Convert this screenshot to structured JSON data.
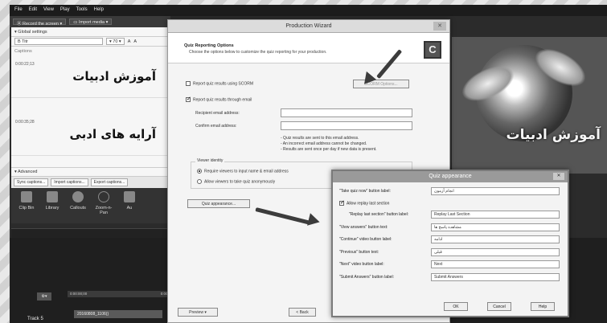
{
  "menu": [
    "File",
    "Edit",
    "View",
    "Play",
    "Tools",
    "Help"
  ],
  "toolbar": {
    "record": "⦿ Record the screen ▾",
    "import": "▭ Import media ▾"
  },
  "captions": {
    "global_settings": "▾ Global settings",
    "font_name": "B Titr",
    "font_size": "▾ 70 ▾",
    "header": "Captions",
    "items": [
      {
        "time": "0:00:22;13",
        "text": "آموزش ادبیات"
      },
      {
        "time": "0:00:35;28",
        "text": "آرایه های ادبی"
      }
    ],
    "advanced": "▾ Advanced",
    "buttons": [
      "Sync captions...",
      "Import captions...",
      "Export captions..."
    ]
  },
  "tools": [
    "Clip Bin",
    "Library",
    "Callouts",
    "Zoom-n-Pan",
    "Au"
  ],
  "timeline": {
    "ruler_a": "0:00:00;00",
    "ruler_b": "0:00:10;00",
    "track": "Track 5",
    "clip": "20160808_1106()"
  },
  "preview": {
    "text": "آموزش ادبیات"
  },
  "wizard": {
    "title": "Production Wizard",
    "heading": "Quiz Reporting Options",
    "subheading": "Choose the options below to customize the quiz reporting for your production.",
    "logo": "C",
    "report_scorm": "Report quiz results using SCORM",
    "scorm_options": "SCORM Options...",
    "report_email": "Report quiz results through email",
    "recipient_label": "Recipient email address:",
    "confirm_label": "Confirm email address:",
    "notes": [
      "- Quiz results are sent to this email address.",
      "- An incorrect email address cannot be changed.",
      "- Results are sent once per day if new data is present."
    ],
    "viewer_identity": "Viewer identity",
    "require_viewers": "Require viewers to input name & email address",
    "allow_anon": "Allow viewers to take quiz anonymously",
    "quiz_appearance": "Quiz appearance...",
    "preview_btn": "Preview ▾",
    "back_btn": "< Back"
  },
  "quiz": {
    "title": "Quiz appearance",
    "close": "✕",
    "rows": [
      {
        "label": "\"Take quiz now\" button label:",
        "value": "انجام آزمون"
      },
      {
        "label": "Allow replay last section",
        "value": ""
      },
      {
        "label": "\"Replay last section\" button label:",
        "value": "Replay Last Section"
      },
      {
        "label": "\"View answers\" button text:",
        "value": "مشاهده پاسخ ها"
      },
      {
        "label": "\"Continue\" video button label:",
        "value": "ادامه"
      },
      {
        "label": "\"Previous\" button text:",
        "value": "قبلی"
      },
      {
        "label": "\"Next\" video button label:",
        "value": "Next"
      },
      {
        "label": "\"Submit Answers\" button label:",
        "value": "Submit Answers"
      }
    ],
    "ok": "OK",
    "cancel": "Cancel",
    "help": "Help"
  }
}
